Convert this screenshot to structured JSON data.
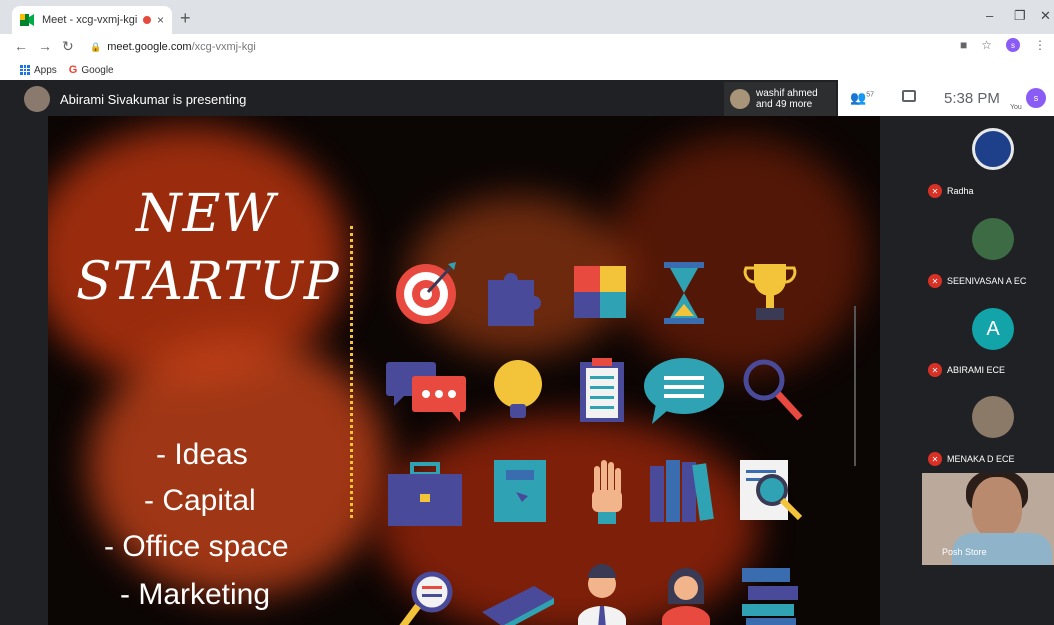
{
  "browser": {
    "tab_title": "Meet - xcg-vxmj-kgi",
    "tab_close": "×",
    "new_tab": "+",
    "win_min": "–",
    "win_max": "❐",
    "win_close": "✕",
    "url_host": "meet.google.com",
    "url_path": "/xcg-vxmj-kgi",
    "profile_initial": "s",
    "bookmarks": [
      "Apps",
      "Google"
    ]
  },
  "meet": {
    "presenting_text": "Abirami Sivakumar is presenting",
    "participants_chip_line1": "washif ahmed",
    "participants_chip_line2": "and 49 more",
    "people_count": "57",
    "time": "5:38 PM",
    "you_label": "You",
    "you_initial": "s"
  },
  "slide": {
    "title_line1": "NEW",
    "title_line2": "STARTUP",
    "bullets": [
      "- Ideas",
      "- Capital",
      "- Office space",
      "- Marketing"
    ]
  },
  "participants": [
    {
      "name": "Radha"
    },
    {
      "name": "SEENIVASAN A EC"
    },
    {
      "name": "ABIRAMI ECE",
      "initial": "A"
    },
    {
      "name": "MENAKA D ECE"
    },
    {
      "name": "Posh Store"
    }
  ],
  "colors": {
    "meet_bg": "#202124",
    "mute_red": "#d93025",
    "avatar_teal": "#12a4a8",
    "flame_orange": "#e2561b"
  }
}
